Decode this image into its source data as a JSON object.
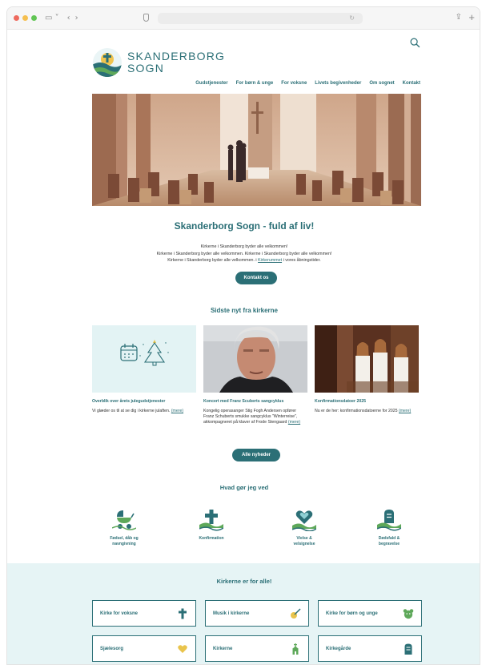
{
  "brand": {
    "name_line1": "SKANDERBORG",
    "name_line2": "SOGN"
  },
  "colors": {
    "primary": "#2b6f76",
    "accent_yellow": "#e9c44c",
    "accent_green": "#5ea85a",
    "bottom_bg": "#e6f4f5"
  },
  "nav": [
    "Gudstjenester",
    "For børn & unge",
    "For voksne",
    "Livets begivenheder",
    "Om sognet",
    "Kontakt"
  ],
  "intro": {
    "title": "Skanderborg Sogn - fuld af liv!",
    "line1": "Kirkerne i Skanderborg byder alle velkommen!",
    "line2": "Kirkerne i Skanderborg byder alle velkommen. Kirkerne i Skanderborg byder alle velkommen!",
    "line3_before": "Kirkerne i Skanderborg byder alle velkommen. i ",
    "line3_link": "Kirkerummet",
    "line3_after": " i vores åbningstider.",
    "contact_button": "Kontakt os"
  },
  "news": {
    "heading": "Sidste nyt fra kirkerne",
    "items": [
      {
        "title": "Overblik over årets julegudstjenester",
        "text": "Vi glæder os til at se dig i kirkerne julaften. ",
        "more": "(mere)",
        "icon": "calendar-christmas-tree-icon"
      },
      {
        "title": "Koncert med Franz Scuberts sangcyklus",
        "text": "Kongelig operasanger Stig Fogh Andersen opfører Franz Schuberts smukke sangcyklus \"Winterreise\", akkompagneret på klaver af Frode Stengaard ",
        "more": "(mere)",
        "icon": "portrait-photo"
      },
      {
        "title": "Konfirmationsdatoer 2025",
        "text": "Nu er de her: konfirmationsdatoerne for 2025 ",
        "more": "(mere)",
        "icon": "confirmation-photo"
      }
    ],
    "all_button": "Alle nyheder"
  },
  "help": {
    "heading": "Hvad gør jeg ved",
    "items": [
      {
        "label": "Fødsel, dåb og\nnavngivning",
        "icon": "stroller-icon"
      },
      {
        "label": "Konfirmation",
        "icon": "cross-icon"
      },
      {
        "label": "Vielse &\nvelsignelse",
        "icon": "heart-icon"
      },
      {
        "label": "Dødsfald &\nbegravelse",
        "icon": "gravestone-icon"
      }
    ]
  },
  "churches": {
    "heading": "Kirkerne er for alle!",
    "cards": [
      {
        "label": "Kirke for voksne",
        "icon": "cross-icon"
      },
      {
        "label": "Musik i kirkerne",
        "icon": "guitar-icon"
      },
      {
        "label": "Kirke for børn og unge",
        "icon": "teddy-bear-icon"
      },
      {
        "label": "Sjælesorg",
        "icon": "heart-hands-icon"
      },
      {
        "label": "Kirkerne",
        "icon": "church-icon"
      },
      {
        "label": "Kirkegårde",
        "icon": "gravestone-icon"
      }
    ]
  }
}
